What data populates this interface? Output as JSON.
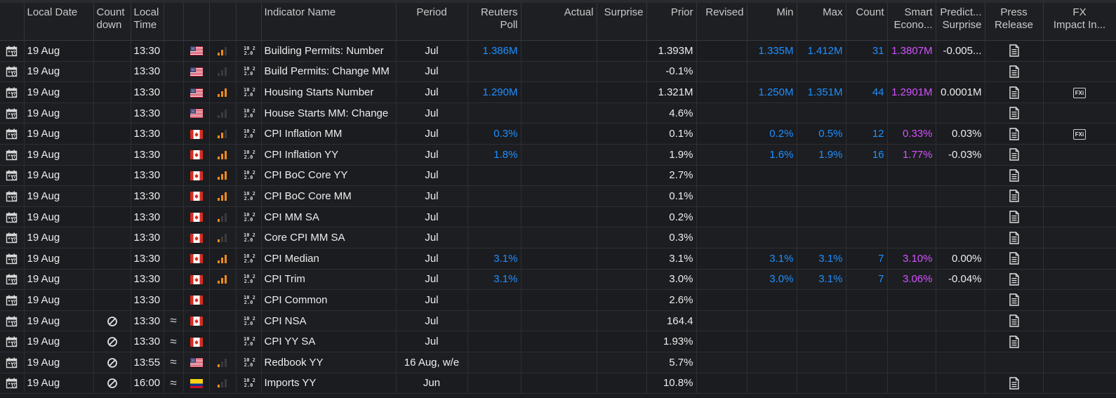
{
  "headers": {
    "local_date": "Local Date",
    "count_down_1": "Count",
    "count_down_2": "down",
    "local_time_1": "Local",
    "local_time_2": "Time",
    "indicator_name": "Indicator Name",
    "period": "Period",
    "reuters_poll_1": "Reuters",
    "reuters_poll_2": "Poll",
    "actual": "Actual",
    "surprise": "Surprise",
    "prior": "Prior",
    "revised": "Revised",
    "min": "Min",
    "max": "Max",
    "count": "Count",
    "smart_1": "Smart",
    "smart_2": "Econo...",
    "predicted_1": "Predict...",
    "predicted_2": "Surprise",
    "press_1": "Press",
    "press_2": "Release",
    "fx_1": "FX",
    "fx_2": "Impact In..."
  },
  "rows": [
    {
      "date": "19 Aug",
      "countdown": false,
      "time": "13:30",
      "approx": false,
      "flag": "us",
      "importance": 2,
      "has_code": true,
      "name": "Building Permits: Number",
      "period": "Jul",
      "poll": "1.386M",
      "actual": "",
      "surprise": "",
      "prior": "1.393M",
      "revised": "",
      "min": "1.335M",
      "max": "1.412M",
      "count": "31",
      "smart": "1.3807M",
      "predicted": "-0.005...",
      "press": true,
      "fx": false
    },
    {
      "date": "19 Aug",
      "countdown": false,
      "time": "13:30",
      "approx": false,
      "flag": "us",
      "importance": 0,
      "has_code": true,
      "name": "Build Permits: Change MM",
      "period": "Jul",
      "poll": "",
      "actual": "",
      "surprise": "",
      "prior": "-0.1%",
      "revised": "",
      "min": "",
      "max": "",
      "count": "",
      "smart": "",
      "predicted": "",
      "press": true,
      "fx": false
    },
    {
      "date": "19 Aug",
      "countdown": false,
      "time": "13:30",
      "approx": false,
      "flag": "us",
      "importance": 3,
      "has_code": true,
      "name": "Housing Starts Number",
      "period": "Jul",
      "poll": "1.290M",
      "actual": "",
      "surprise": "",
      "prior": "1.321M",
      "revised": "",
      "min": "1.250M",
      "max": "1.351M",
      "count": "44",
      "smart": "1.2901M",
      "predicted": "0.0001M",
      "press": true,
      "fx": true
    },
    {
      "date": "19 Aug",
      "countdown": false,
      "time": "13:30",
      "approx": false,
      "flag": "us",
      "importance": 0,
      "has_code": true,
      "name": "House Starts MM: Change",
      "period": "Jul",
      "poll": "",
      "actual": "",
      "surprise": "",
      "prior": "4.6%",
      "revised": "",
      "min": "",
      "max": "",
      "count": "",
      "smart": "",
      "predicted": "",
      "press": true,
      "fx": false
    },
    {
      "date": "19 Aug",
      "countdown": false,
      "time": "13:30",
      "approx": false,
      "flag": "ca",
      "importance": 2,
      "has_code": true,
      "name": "CPI Inflation MM",
      "period": "Jul",
      "poll": "0.3%",
      "actual": "",
      "surprise": "",
      "prior": "0.1%",
      "revised": "",
      "min": "0.2%",
      "max": "0.5%",
      "count": "12",
      "smart": "0.33%",
      "predicted": "0.03%",
      "press": true,
      "fx": true
    },
    {
      "date": "19 Aug",
      "countdown": false,
      "time": "13:30",
      "approx": false,
      "flag": "ca",
      "importance": 3,
      "has_code": true,
      "name": "CPI Inflation YY",
      "period": "Jul",
      "poll": "1.8%",
      "actual": "",
      "surprise": "",
      "prior": "1.9%",
      "revised": "",
      "min": "1.6%",
      "max": "1.9%",
      "count": "16",
      "smart": "1.77%",
      "predicted": "-0.03%",
      "press": true,
      "fx": false
    },
    {
      "date": "19 Aug",
      "countdown": false,
      "time": "13:30",
      "approx": false,
      "flag": "ca",
      "importance": 3,
      "has_code": true,
      "name": "CPI BoC Core YY",
      "period": "Jul",
      "poll": "",
      "actual": "",
      "surprise": "",
      "prior": "2.7%",
      "revised": "",
      "min": "",
      "max": "",
      "count": "",
      "smart": "",
      "predicted": "",
      "press": true,
      "fx": false
    },
    {
      "date": "19 Aug",
      "countdown": false,
      "time": "13:30",
      "approx": false,
      "flag": "ca",
      "importance": 3,
      "has_code": true,
      "name": "CPI BoC Core MM",
      "period": "Jul",
      "poll": "",
      "actual": "",
      "surprise": "",
      "prior": "0.1%",
      "revised": "",
      "min": "",
      "max": "",
      "count": "",
      "smart": "",
      "predicted": "",
      "press": true,
      "fx": false
    },
    {
      "date": "19 Aug",
      "countdown": false,
      "time": "13:30",
      "approx": false,
      "flag": "ca",
      "importance": 1,
      "has_code": true,
      "name": "CPI MM SA",
      "period": "Jul",
      "poll": "",
      "actual": "",
      "surprise": "",
      "prior": "0.2%",
      "revised": "",
      "min": "",
      "max": "",
      "count": "",
      "smart": "",
      "predicted": "",
      "press": true,
      "fx": false
    },
    {
      "date": "19 Aug",
      "countdown": false,
      "time": "13:30",
      "approx": false,
      "flag": "ca",
      "importance": 1,
      "has_code": true,
      "name": "Core CPI MM SA",
      "period": "Jul",
      "poll": "",
      "actual": "",
      "surprise": "",
      "prior": "0.3%",
      "revised": "",
      "min": "",
      "max": "",
      "count": "",
      "smart": "",
      "predicted": "",
      "press": true,
      "fx": false
    },
    {
      "date": "19 Aug",
      "countdown": false,
      "time": "13:30",
      "approx": false,
      "flag": "ca",
      "importance": 3,
      "has_code": true,
      "name": "CPI Median",
      "period": "Jul",
      "poll": "3.1%",
      "actual": "",
      "surprise": "",
      "prior": "3.1%",
      "revised": "",
      "min": "3.1%",
      "max": "3.1%",
      "count": "7",
      "smart": "3.10%",
      "predicted": "0.00%",
      "press": true,
      "fx": false
    },
    {
      "date": "19 Aug",
      "countdown": false,
      "time": "13:30",
      "approx": false,
      "flag": "ca",
      "importance": 3,
      "has_code": true,
      "name": "CPI Trim",
      "period": "Jul",
      "poll": "3.1%",
      "actual": "",
      "surprise": "",
      "prior": "3.0%",
      "revised": "",
      "min": "3.0%",
      "max": "3.1%",
      "count": "7",
      "smart": "3.06%",
      "predicted": "-0.04%",
      "press": true,
      "fx": false
    },
    {
      "date": "19 Aug",
      "countdown": false,
      "time": "13:30",
      "approx": false,
      "flag": "ca",
      "importance": -1,
      "has_code": true,
      "name": "CPI Common",
      "period": "Jul",
      "poll": "",
      "actual": "",
      "surprise": "",
      "prior": "2.6%",
      "revised": "",
      "min": "",
      "max": "",
      "count": "",
      "smart": "",
      "predicted": "",
      "press": true,
      "fx": false
    },
    {
      "date": "19 Aug",
      "countdown": true,
      "time": "13:30",
      "approx": true,
      "flag": "ca",
      "importance": -1,
      "has_code": true,
      "name": "CPI NSA",
      "period": "Jul",
      "poll": "",
      "actual": "",
      "surprise": "",
      "prior": "164.4",
      "revised": "",
      "min": "",
      "max": "",
      "count": "",
      "smart": "",
      "predicted": "",
      "press": true,
      "fx": false
    },
    {
      "date": "19 Aug",
      "countdown": true,
      "time": "13:30",
      "approx": true,
      "flag": "ca",
      "importance": -1,
      "has_code": true,
      "name": "CPI YY SA",
      "period": "Jul",
      "poll": "",
      "actual": "",
      "surprise": "",
      "prior": "1.93%",
      "revised": "",
      "min": "",
      "max": "",
      "count": "",
      "smart": "",
      "predicted": "",
      "press": true,
      "fx": false
    },
    {
      "date": "19 Aug",
      "countdown": true,
      "time": "13:55",
      "approx": true,
      "flag": "us",
      "importance": 1,
      "has_code": true,
      "name": "Redbook YY",
      "period": "16 Aug, w/e",
      "poll": "",
      "actual": "",
      "surprise": "",
      "prior": "5.7%",
      "revised": "",
      "min": "",
      "max": "",
      "count": "",
      "smart": "",
      "predicted": "",
      "press": false,
      "fx": false
    },
    {
      "date": "19 Aug",
      "countdown": true,
      "time": "16:00",
      "approx": true,
      "flag": "co",
      "importance": 1,
      "has_code": true,
      "name": "Imports YY",
      "period": "Jun",
      "poll": "",
      "actual": "",
      "surprise": "",
      "prior": "10.8%",
      "revised": "",
      "min": "",
      "max": "",
      "count": "",
      "smart": "",
      "predicted": "",
      "press": true,
      "fx": false
    }
  ],
  "colors": {
    "poll": "#1e8fff",
    "range": "#1e8fff",
    "smart": "#d452ff",
    "importance_on": "#f28c1a",
    "importance_off": "#3b3b3b"
  },
  "icons": {
    "row": "calendar-event-icon",
    "countdown": "no-countdown-icon",
    "code": "code-2.0-icon",
    "press": "document-icon",
    "fx": "fx-impact-icon"
  },
  "labels": {
    "code_top": "10 2",
    "code_bottom": "2.0",
    "fx_label": "FXi"
  }
}
